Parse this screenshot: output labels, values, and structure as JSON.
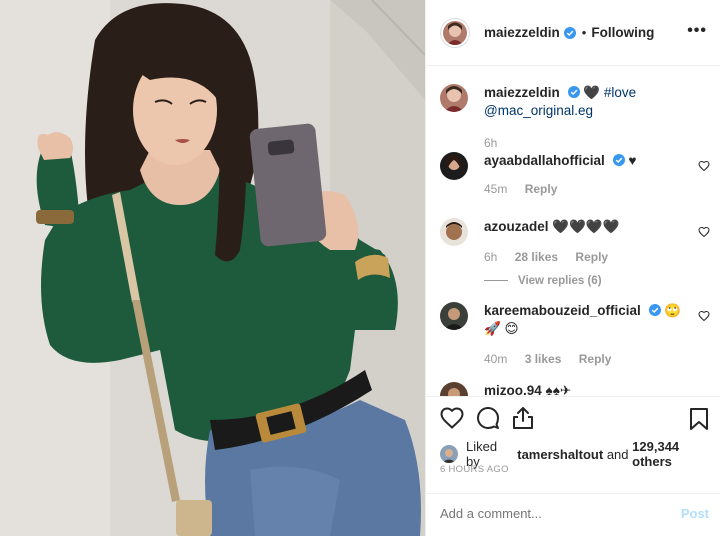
{
  "post": {
    "username": "maiezzeldin",
    "follow_dot": "•",
    "follow_label": "Following",
    "more_label": "•••"
  },
  "caption": {
    "username": "maiezzeldin",
    "hearts": "🖤",
    "hashtag": "#love",
    "mention": "@mac_original.eg",
    "age": "6h"
  },
  "comments": [
    {
      "username": "ayaabdallahofficial",
      "text": "♥",
      "age": "45m",
      "likes": "",
      "reply": "Reply"
    },
    {
      "username": "azouzadel",
      "text": "🖤🖤🖤🖤",
      "age": "6h",
      "likes": "28 likes",
      "reply": "Reply",
      "view_replies": "View replies (6)"
    },
    {
      "username": "kareemabouzeid_official",
      "text": "🙄🚀 😊",
      "age": "40m",
      "likes": "3 likes",
      "reply": "Reply"
    },
    {
      "username": "mizoo.94",
      "text": "♠♠✈",
      "age": "",
      "likes": "",
      "reply": ""
    }
  ],
  "likes": {
    "prefix": "Liked by",
    "user": "tamershaltout",
    "connector": "and",
    "count": "129,344 others"
  },
  "timestamp": "6 HOURS AGO",
  "composer": {
    "placeholder": "Add a comment...",
    "post_label": "Post"
  },
  "colors": {
    "verified": "#3897f0",
    "link": "#003569",
    "meta": "#999999",
    "post_disabled": "#b2dffc",
    "sweater": "#1e5a3c"
  }
}
